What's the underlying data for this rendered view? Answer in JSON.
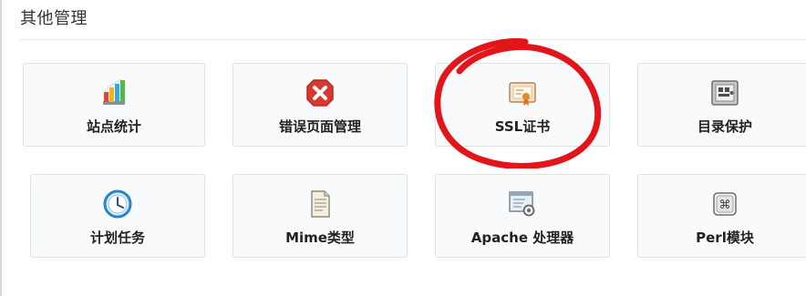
{
  "section": {
    "title": "其他管理"
  },
  "tiles": [
    {
      "label": "站点统计",
      "icon": "bar-chart-icon"
    },
    {
      "label": "错误页面管理",
      "icon": "error-x-icon"
    },
    {
      "label": "SSL证书",
      "icon": "certificate-icon"
    },
    {
      "label": "目录保护",
      "icon": "safe-icon"
    },
    {
      "label": "计划任务",
      "icon": "clock-icon"
    },
    {
      "label": "Mime类型",
      "icon": "document-icon"
    },
    {
      "label": "Apache 处理器",
      "icon": "window-gear-icon"
    },
    {
      "label": "Perl模块",
      "icon": "command-key-icon"
    }
  ],
  "annotation": {
    "color": "#e3151a",
    "target": "SSL证书"
  }
}
